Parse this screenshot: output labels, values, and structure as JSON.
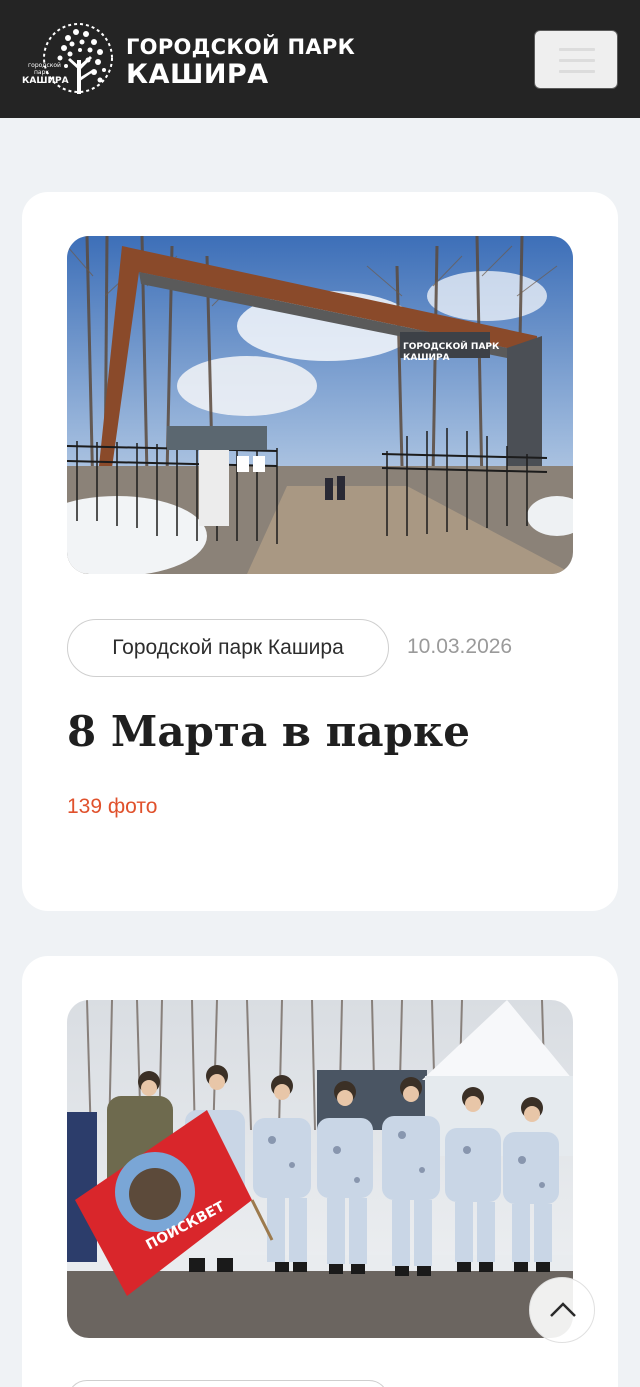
{
  "header": {
    "logo_small_lines": [
      "городской",
      "парк",
      "КАШИРА"
    ],
    "logo_title_line1": "ГОРОДСКОЙ ПАРК",
    "logo_title_line2": "КАШИРА",
    "menu_icon": "hamburger-icon",
    "colors": {
      "background": "#242424",
      "text": "#ffffff"
    }
  },
  "albums": [
    {
      "tag": "Городской парк Кашира",
      "date": "10.03.2026",
      "title": "8 Марта в парке",
      "photo_count": "139 фото",
      "photo_alt": "Арка входа в городской парк Кашира зимой",
      "gate_sign": "ГОРОДСКОЙ ПАРК КАШИРА"
    },
    {
      "photo_alt": "Юнармейцы в зимних маскхалатах с красным флагом",
      "flag_text": "ПОИСКВЕТ"
    }
  ],
  "colors": {
    "page_bg": "#eff2f5",
    "card_bg": "#ffffff",
    "accent": "#e0512c",
    "muted": "#9a9a9a"
  },
  "scroll_top_icon": "chevron-up-icon"
}
